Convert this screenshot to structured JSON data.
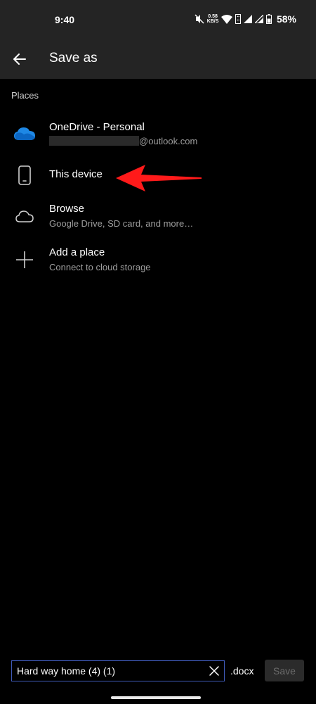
{
  "status_bar": {
    "time": "9:40",
    "net_speed_value": "0.58",
    "net_speed_unit": "KB/S",
    "battery_percent": "58%"
  },
  "app_bar": {
    "title": "Save as",
    "back_icon": "arrow-left-icon"
  },
  "places": {
    "section_label": "Places",
    "items": [
      {
        "title": "OneDrive - Personal",
        "subtitle": "@outlook.com",
        "icon": "onedrive-cloud-icon"
      },
      {
        "title": "This device",
        "subtitle": "",
        "icon": "phone-icon"
      },
      {
        "title": "Browse",
        "subtitle": "Google Drive, SD card, and more…",
        "icon": "cloud-outline-icon"
      },
      {
        "title": "Add a place",
        "subtitle": "Connect to cloud storage",
        "icon": "plus-icon"
      }
    ]
  },
  "file_bar": {
    "filename_value": "Hard way home (4) (1)",
    "extension": ".docx",
    "save_label": "Save"
  },
  "colors": {
    "app_bar_bg": "#242424",
    "background": "#000000",
    "onedrive_blue": "#1e88e5",
    "input_border": "#3f5ab8",
    "annotation_red": "#ff1a1a"
  }
}
